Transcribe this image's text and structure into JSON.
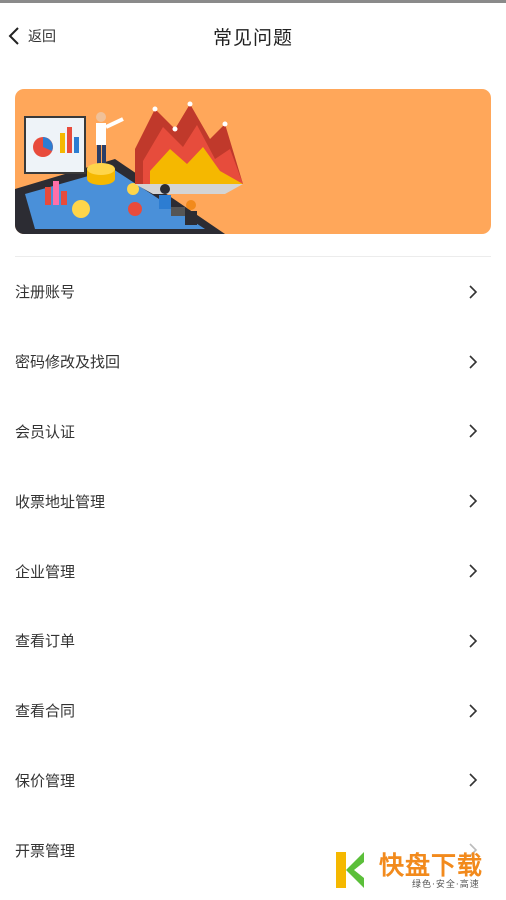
{
  "header": {
    "back_label": "返回",
    "title": "常见问题"
  },
  "banner": {
    "background_color": "#ffa75a",
    "illustration": "business-data-analysis-illustration"
  },
  "faq_items": [
    {
      "label": "注册账号"
    },
    {
      "label": "密码修改及找回"
    },
    {
      "label": "会员认证"
    },
    {
      "label": "收票地址管理"
    },
    {
      "label": "企业管理"
    },
    {
      "label": "查看订单"
    },
    {
      "label": "查看合同"
    },
    {
      "label": "保价管理"
    },
    {
      "label": "开票管理"
    }
  ],
  "watermark": {
    "logo_text": "快",
    "title": "快盘下载",
    "subtitle": "绿色·安全·高速"
  }
}
